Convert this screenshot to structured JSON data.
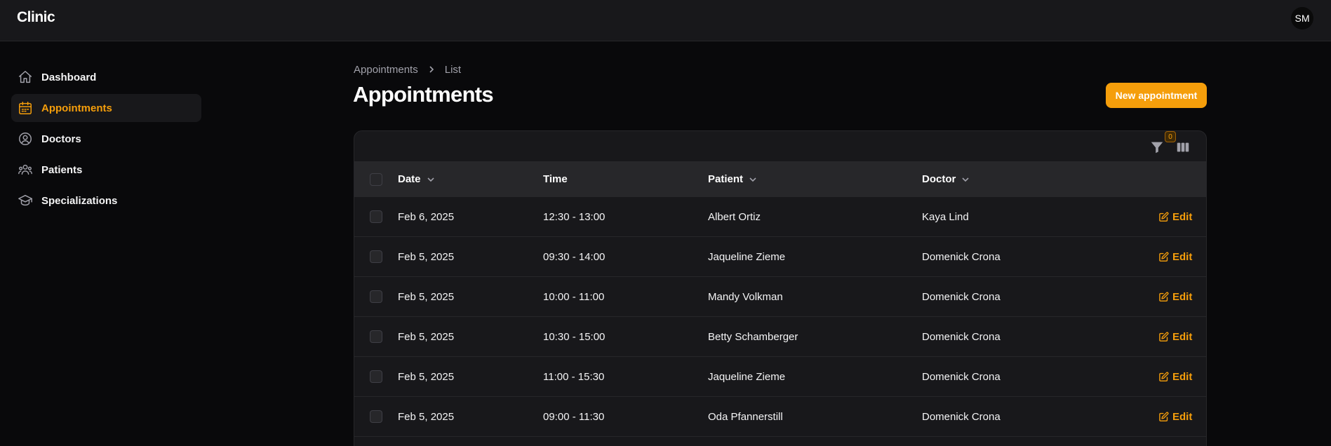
{
  "app": {
    "brand": "Clinic",
    "user_initials": "SM"
  },
  "sidebar": {
    "items": [
      {
        "label": "Dashboard",
        "icon": "home-icon",
        "active": false
      },
      {
        "label": "Appointments",
        "icon": "calendar-icon",
        "active": true
      },
      {
        "label": "Doctors",
        "icon": "user-circle-icon",
        "active": false
      },
      {
        "label": "Patients",
        "icon": "users-icon",
        "active": false
      },
      {
        "label": "Specializations",
        "icon": "academic-cap-icon",
        "active": false
      }
    ]
  },
  "breadcrumb": {
    "parent": "Appointments",
    "current": "List"
  },
  "page": {
    "title": "Appointments",
    "new_button": "New appointment"
  },
  "colors": {
    "accent": "#f59e0b",
    "background": "#09090b",
    "surface": "#18181b"
  },
  "table": {
    "filter_count": "0",
    "columns": {
      "date": "Date",
      "time": "Time",
      "patient": "Patient",
      "doctor": "Doctor"
    },
    "edit_label": "Edit",
    "rows": [
      {
        "date": "Feb 6, 2025",
        "time": "12:30 - 13:00",
        "patient": "Albert Ortiz",
        "doctor": "Kaya Lind"
      },
      {
        "date": "Feb 5, 2025",
        "time": "09:30 - 14:00",
        "patient": "Jaqueline Zieme",
        "doctor": "Domenick Crona"
      },
      {
        "date": "Feb 5, 2025",
        "time": "10:00 - 11:00",
        "patient": "Mandy Volkman",
        "doctor": "Domenick Crona"
      },
      {
        "date": "Feb 5, 2025",
        "time": "10:30 - 15:00",
        "patient": "Betty Schamberger",
        "doctor": "Domenick Crona"
      },
      {
        "date": "Feb 5, 2025",
        "time": "11:00 - 15:30",
        "patient": "Jaqueline Zieme",
        "doctor": "Domenick Crona"
      },
      {
        "date": "Feb 5, 2025",
        "time": "09:00 - 11:30",
        "patient": "Oda Pfannerstill",
        "doctor": "Domenick Crona"
      }
    ]
  }
}
